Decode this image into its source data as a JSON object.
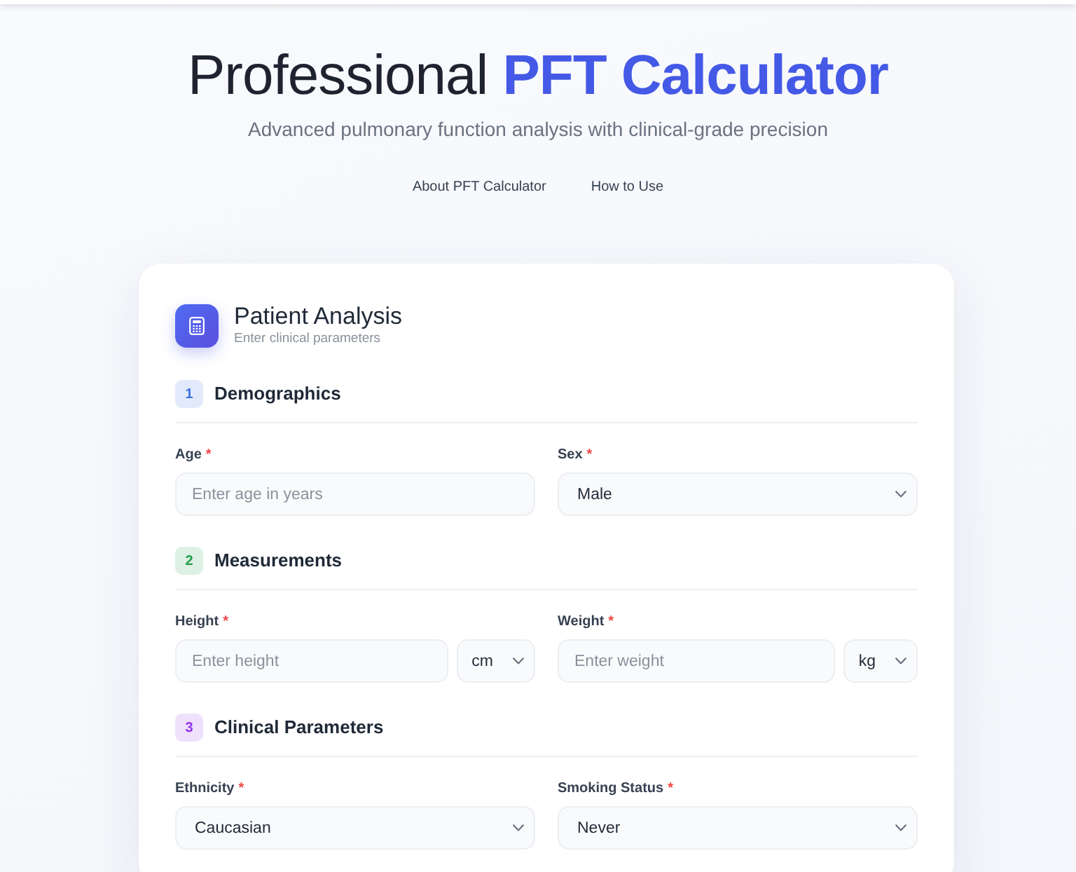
{
  "hero": {
    "title": "Professional **PFT Calculator**",
    "subtitle": "Advanced pulmonary function analysis with clinical-grade precision",
    "links": [
      "About PFT Calculator",
      "How to Use"
    ]
  },
  "card": {
    "title": "Patient Analysis",
    "subtitle": "Enter clinical parameters",
    "sections": [
      {
        "number": "1",
        "title": "Demographics",
        "color": "#3b6fe0",
        "fields": [
          {
            "kind": "input",
            "label": "Age",
            "required_mark": "*",
            "placeholder": "Enter age in years"
          },
          {
            "kind": "select",
            "label": "Sex",
            "required_mark": "*",
            "value": "Male"
          }
        ]
      },
      {
        "number": "2",
        "title": "Measurements",
        "color": "#22a04b",
        "fields": [
          {
            "kind": "input_unit",
            "label": "Height",
            "required_mark": "*",
            "placeholder": "Enter height",
            "unit": "cm"
          },
          {
            "kind": "input_unit",
            "label": "Weight",
            "required_mark": "*",
            "placeholder": "Enter weight",
            "unit": "kg"
          }
        ]
      },
      {
        "number": "3",
        "title": "Clinical Parameters",
        "color": "#9333ea",
        "fields": [
          {
            "kind": "select",
            "label": "Ethnicity",
            "required_mark": "*",
            "value": "Caucasian"
          },
          {
            "kind": "select",
            "label": "Smoking Status",
            "required_mark": "*",
            "value": "Never"
          }
        ]
      }
    ]
  }
}
